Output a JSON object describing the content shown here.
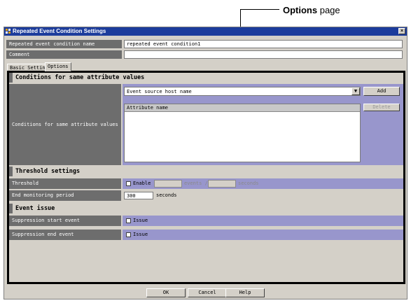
{
  "callout": {
    "bold": "Options",
    "rest": " page"
  },
  "window": {
    "title": "Repeated Event Condition Settings",
    "close": "×"
  },
  "fields": {
    "name_label": "Repeated event condition name",
    "name_value": "repeated event condition1",
    "comment_label": "Comment",
    "comment_value": ""
  },
  "tabs": [
    {
      "label": "Basic Settings"
    },
    {
      "label": "Options"
    }
  ],
  "sections": {
    "same_attr": {
      "title": "Conditions for same attribute values",
      "row_label": "Conditions for same attribute values",
      "dropdown_value": "Event source host name",
      "add_button": "Add",
      "delete_button": "Delete",
      "list_header": "Attribute name"
    },
    "threshold": {
      "title": "Threshold settings",
      "threshold_label": "Threshold",
      "enable_label": "Enable",
      "events_unit": "events /",
      "seconds_unit": "seconds",
      "end_label": "End monitoring period",
      "end_value": "300",
      "end_unit": "seconds"
    },
    "issue": {
      "title": "Event issue",
      "start_label": "Suppression start event",
      "start_check": "Issue",
      "end_label": "Suppression end event",
      "end_check": "Issue"
    }
  },
  "buttons": {
    "ok": "OK",
    "cancel": "Cancel",
    "help": "Help"
  },
  "colors": {
    "title_bar": "#1c3c9c",
    "label_bg": "#6d6d6d",
    "lavender": "#9896cc",
    "dialog_bg": "#d4d0c8"
  }
}
